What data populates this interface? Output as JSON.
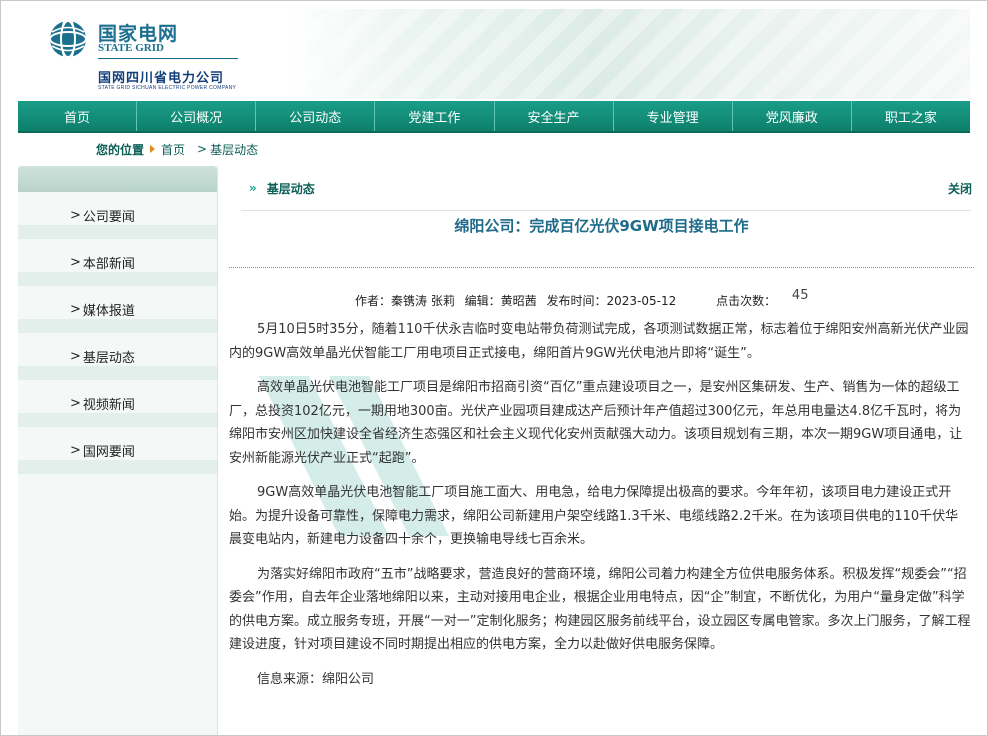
{
  "header": {
    "logo_cn": "国家电网",
    "logo_en": "STATE GRID",
    "company_cn": "国网四川省电力公司",
    "company_en": "STATE GRID SICHUAN ELECTRIC POWER COMPANY",
    "brand_color": "#1c6f8f"
  },
  "nav": {
    "items": [
      "首页",
      "公司概况",
      "公司动态",
      "党建工作",
      "安全生产",
      "专业管理",
      "党风廉政",
      "职工之家"
    ],
    "color": "#0d7f6b"
  },
  "breadcrumb": {
    "position_label": "您的位置",
    "home": "首页",
    "current": "基层动态"
  },
  "sidebar": {
    "items": [
      "公司要闻",
      "本部新闻",
      "媒体报道",
      "基层动态",
      "视频新闻",
      "国网要闻"
    ]
  },
  "section": {
    "title": "基层动态",
    "close": "关闭"
  },
  "article": {
    "title": "绵阳公司：完成百亿光伏9GW项目接电工作",
    "author": "作者：秦镌涛 张莉",
    "editor": "编辑：黄昭茜",
    "date": "发布时间：2023-05-12",
    "clicks_label": "点击次数：",
    "clicks": "45",
    "paragraphs": [
      "5月10日5时35分，随着110千伏永吉临时变电站带负荷测试完成，各项测试数据正常，标志着位于绵阳安州高新光伏产业园内的9GW高效单晶光伏智能工厂用电项目正式接电，绵阳首片9GW光伏电池片即将“诞生”。",
      "高效单晶光伏电池智能工厂项目是绵阳市招商引资“百亿”重点建设项目之一，是安州区集研发、生产、销售为一体的超级工厂，总投资102亿元，一期用地300亩。光伏产业园项目建成达产后预计年产值超过300亿元，年总用电量达4.8亿千瓦时，将为绵阳市安州区加快建设全省经济生态强区和社会主义现代化安州贡献强大动力。该项目规划有三期，本次一期9GW项目通电，让安州新能源光伏产业正式“起跑”。",
      "9GW高效单晶光伏电池智能工厂项目施工面大、用电急，给电力保障提出极高的要求。今年年初，该项目电力建设正式开始。为提升设备可靠性，保障电力需求，绵阳公司新建用户架空线路1.3千米、电缆线路2.2千米。在为该项目供电的110千伏华晨变电站内，新建电力设备四十余个，更换输电导线七百余米。",
      "为落实好绵阳市政府“五市”战略要求，营造良好的营商环境，绵阳公司着力构建全方位供电服务体系。积极发挥“规委会”“招委会”作用，自去年企业落地绵阳以来，主动对接用电企业，根据企业用电特点，因“企”制宜，不断优化，为用户“量身定做”科学的供电方案。成立服务专班，开展“一对一”定制化服务；构建园区服务前线平台，设立园区专属电管家。多次上门服务，了解工程建设进度，针对项目建设不同时期提出相应的供电方案，全力以赴做好供电服务保障。"
    ],
    "source": "信息来源：绵阳公司"
  }
}
